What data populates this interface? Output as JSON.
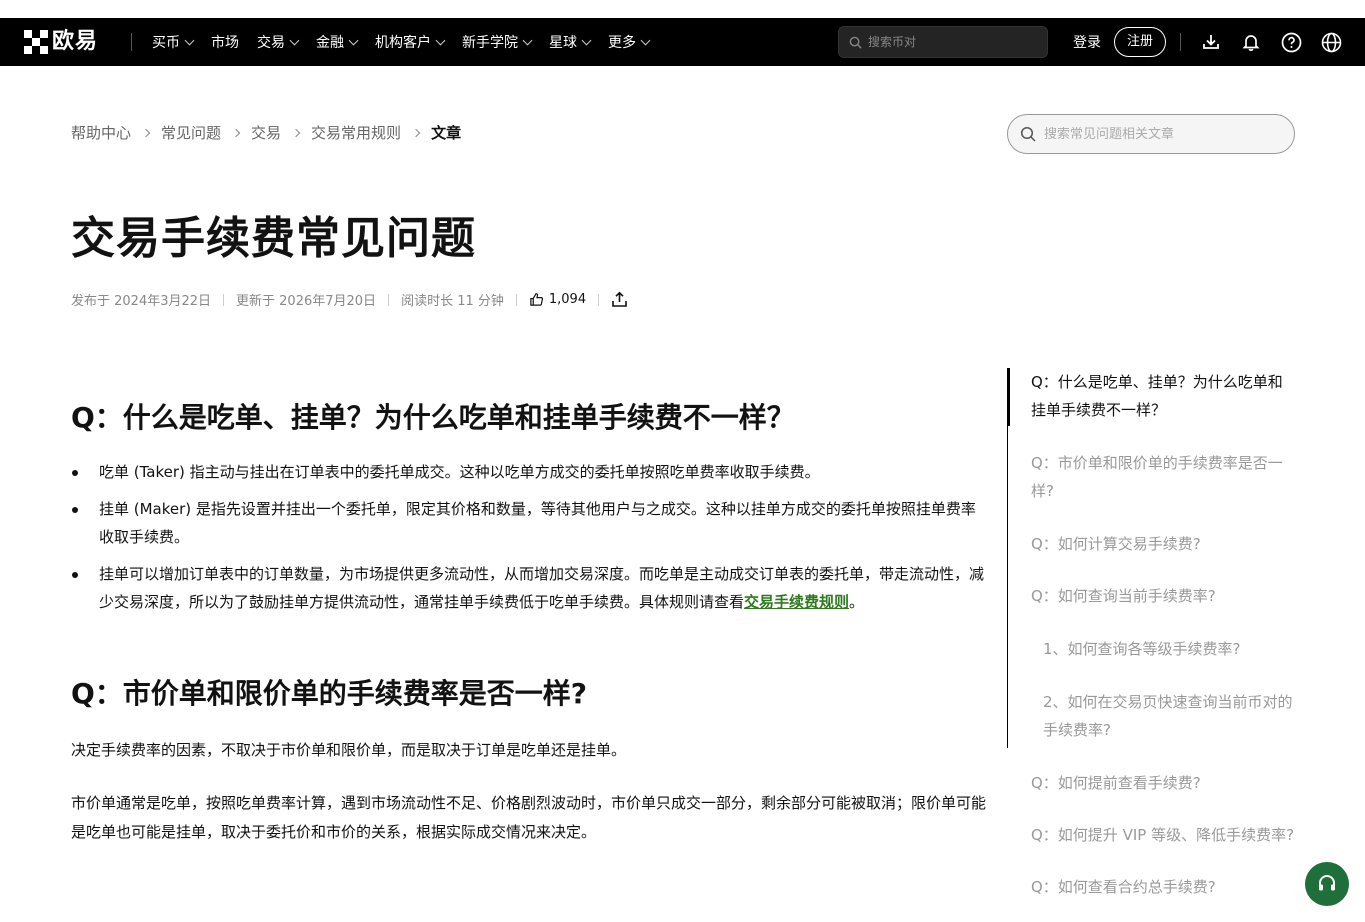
{
  "header": {
    "logo_text": "欧易",
    "nav": [
      {
        "label": "买币",
        "dropdown": true
      },
      {
        "label": "市场",
        "dropdown": false
      },
      {
        "label": "交易",
        "dropdown": true
      },
      {
        "label": "金融",
        "dropdown": true
      },
      {
        "label": "机构客户",
        "dropdown": true
      },
      {
        "label": "新手学院",
        "dropdown": true
      },
      {
        "label": "星球",
        "dropdown": true
      },
      {
        "label": "更多",
        "dropdown": true
      }
    ],
    "search_placeholder": "搜索币对",
    "login_label": "登录",
    "register_label": "注册",
    "icons": [
      "download-icon",
      "bell-icon",
      "help-icon",
      "globe-icon"
    ]
  },
  "breadcrumb": [
    "帮助中心",
    "常见问题",
    "交易",
    "交易常用规则",
    "文章"
  ],
  "help_search_placeholder": "搜索常见问题相关文章",
  "article": {
    "title": "交易手续费常见问题",
    "published": "发布于 2024年3月22日",
    "updated": "更新于 2026年7月20日",
    "read_time": "阅读时长 11 分钟",
    "likes": "1,094",
    "section1": {
      "heading": "Q：什么是吃单、挂单？为什么吃单和挂单手续费不一样？",
      "bullet1": "吃单 (Taker) 指主动与挂出在订单表中的委托单成交。这种以吃单方成交的委托单按照吃单费率收取手续费。",
      "bullet2": "挂单 (Maker) 是指先设置并挂出一个委托单，限定其价格和数量，等待其他用户与之成交。这种以挂单方成交的委托单按照挂单费率收取手续费。",
      "bullet3_text": "挂单可以增加订单表中的订单数量，为市场提供更多流动性，从而增加交易深度。而吃单是主动成交订单表的委托单，带走流动性，减少交易深度，所以为了鼓励挂单方提供流动性，通常挂单手续费低于吃单手续费。具体规则请查看",
      "bullet3_link": "交易手续费规则",
      "bullet3_end": "。"
    },
    "section2": {
      "heading": "Q：市价单和限价单的手续费率是否一样?",
      "para1": "决定手续费率的因素，不取决于市价单和限价单，而是取决于订单是吃单还是挂单。",
      "para2": "市价单通常是吃单，按照吃单费率计算，遇到市场流动性不足、价格剧烈波动时，市价单只成交一部分，剩余部分可能被取消；限价单可能是吃单也可能是挂单，取决于委托价和市价的关系，根据实际成交情况来决定。"
    }
  },
  "toc": [
    {
      "label": "Q：什么是吃单、挂单？为什么吃单和挂单手续费不一样？",
      "active": true,
      "sub": false
    },
    {
      "label": "Q：市价单和限价单的手续费率是否一样?",
      "active": false,
      "sub": false
    },
    {
      "label": "Q：如何计算交易手续费?",
      "active": false,
      "sub": false
    },
    {
      "label": "Q：如何查询当前手续费率?",
      "active": false,
      "sub": false
    },
    {
      "label": "1、如何查询各等级手续费率?",
      "active": false,
      "sub": true
    },
    {
      "label": "2、如何在交易页快速查询当前币对的手续费率?",
      "active": false,
      "sub": true
    },
    {
      "label": "Q：如何提前查看手续费?",
      "active": false,
      "sub": false
    },
    {
      "label": "Q：如何提升 VIP 等级、降低手续费率?",
      "active": false,
      "sub": false
    },
    {
      "label": "Q：如何查看合约总手续费?",
      "active": false,
      "sub": false
    }
  ],
  "colors": {
    "link": "#2f7a1f",
    "support_button": "#1f6f3a",
    "navbar": "#000000"
  }
}
